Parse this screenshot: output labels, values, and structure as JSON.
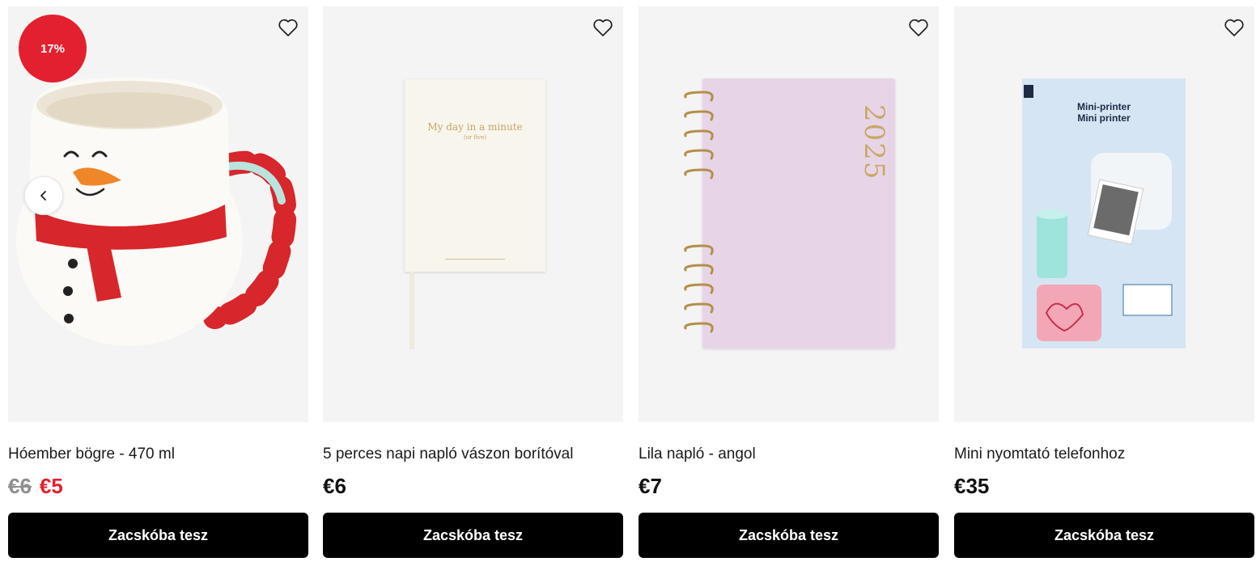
{
  "products": [
    {
      "badge": "17%",
      "name": "Hóember bögre - 470 ml",
      "old_price": "€6",
      "price": "€5",
      "button": "Zacskóba tesz"
    },
    {
      "name": "5 perces napi napló vászon borítóval",
      "price": "€6",
      "button": "Zacskóba tesz",
      "cover_title": "My day in a minute",
      "cover_sub": "(or five)"
    },
    {
      "name": "Lila napló - angol",
      "price": "€7",
      "button": "Zacskóba tesz",
      "cover_year": "2025"
    },
    {
      "name": "Mini nyomtató telefonhoz",
      "price": "€35",
      "button": "Zacskóba tesz",
      "box_line1": "Mini-printer",
      "box_line2": "Mini printer"
    }
  ],
  "colors": {
    "sale_red": "#e3202f",
    "button_bg": "#000000",
    "image_bg": "#f4f4f4"
  },
  "icons": [
    "heart-outline-icon",
    "chevron-left-icon"
  ]
}
